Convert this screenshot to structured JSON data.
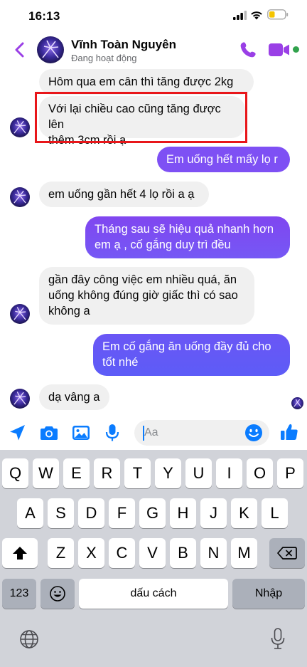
{
  "status_bar": {
    "time": "16:13"
  },
  "header": {
    "contact_name": "Vĩnh Toàn Nguyên",
    "contact_status": "Đang hoạt động"
  },
  "messages": [
    {
      "side": "in",
      "text": "Hôm qua em cân thì tăng được 2kg"
    },
    {
      "side": "in",
      "lines": [
        "Với lại chiều cao cũng tăng được lên",
        "thêm 3cm rồi ạ"
      ]
    },
    {
      "side": "out",
      "text": "Em uống hết mấy lọ r"
    },
    {
      "side": "in",
      "text": "em uống gần hết 4 lọ rồi a ạ"
    },
    {
      "side": "out",
      "lines": [
        "Tháng sau sẽ hiệu quả nhanh hơn",
        "em ạ , cố gắng duy trì đều"
      ]
    },
    {
      "side": "in",
      "lines": [
        "gần đây công việc em nhiều quá, ăn",
        "uống không đúng giờ giấc thì có sao",
        "không a"
      ]
    },
    {
      "side": "out",
      "lines": [
        "Em cố gắng ăn uống đầy đủ cho",
        "tốt nhé"
      ]
    },
    {
      "side": "in",
      "text": "dạ vâng a"
    }
  ],
  "composer": {
    "placeholder": "Aa"
  },
  "keyboard": {
    "row1": [
      "Q",
      "W",
      "E",
      "R",
      "T",
      "Y",
      "U",
      "I",
      "O",
      "P"
    ],
    "row2": [
      "A",
      "S",
      "D",
      "F",
      "G",
      "H",
      "J",
      "K",
      "L"
    ],
    "row3": [
      "Z",
      "X",
      "C",
      "V",
      "B",
      "N",
      "M"
    ],
    "numbers_key": "123",
    "space_key": "dấu cách",
    "return_key": "Nhập"
  },
  "colors": {
    "accent": "#9a3fe6",
    "bubble_out_top": "#8c4bf2",
    "bubble_out_bottom": "#5d5cf7",
    "bubble_in": "#f0f0f0",
    "highlight": "#e8161a"
  }
}
